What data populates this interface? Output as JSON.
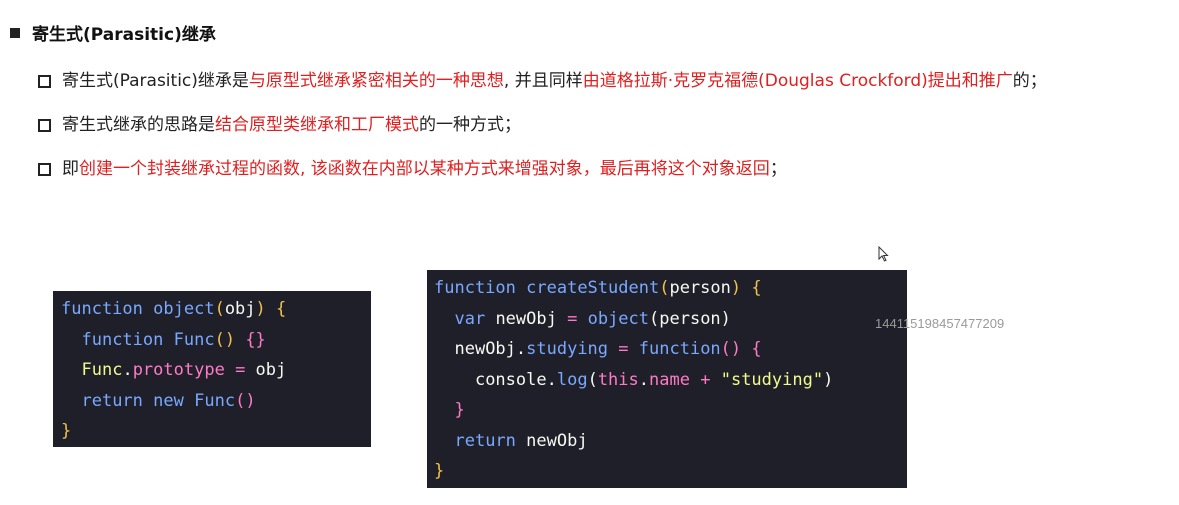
{
  "heading": "寄生式(Parasitic)继承",
  "bullets": [
    {
      "parts": [
        {
          "t": "寄生式(Parasitic)继承是",
          "red": false
        },
        {
          "t": "与原型式继承紧密相关的一种思想",
          "red": true
        },
        {
          "t": ", 并且同样",
          "red": false
        },
        {
          "t": "由道格拉斯·克罗克福德(Douglas Crockford)提出和推广",
          "red": true
        },
        {
          "t": "的；",
          "red": false
        }
      ]
    },
    {
      "parts": [
        {
          "t": "寄生式继承的思路是",
          "red": false
        },
        {
          "t": "结合原型类继承和工厂模式",
          "red": true
        },
        {
          "t": "的一种方式；",
          "red": false
        }
      ]
    },
    {
      "parts": [
        {
          "t": "即",
          "red": false
        },
        {
          "t": "创建一个封装继承过程的函数, 该函数在内部以某种方式来增强对象，最后再将这个对象返回",
          "red": true
        },
        {
          "t": "；",
          "red": false
        }
      ]
    }
  ],
  "code_blocks": [
    {
      "name": "object-function-code",
      "lines": [
        [
          [
            "function",
            "kw"
          ],
          [
            " ",
            ""
          ],
          [
            "object",
            "fn"
          ],
          [
            "(",
            "br"
          ],
          [
            "obj",
            ""
          ],
          [
            ")",
            "br"
          ],
          [
            " ",
            ""
          ],
          [
            "{",
            "br"
          ]
        ],
        [
          [
            "  ",
            ""
          ],
          [
            "function",
            "kw"
          ],
          [
            " ",
            ""
          ],
          [
            "Func",
            "fn"
          ],
          [
            "()",
            "br"
          ],
          [
            " ",
            ""
          ],
          [
            "{}",
            "pr"
          ]
        ],
        [
          [
            "  ",
            ""
          ],
          [
            "Func",
            "st"
          ],
          [
            ".",
            ""
          ],
          [
            "prototype",
            "pr"
          ],
          [
            " ",
            ""
          ],
          [
            "=",
            "pr"
          ],
          [
            " obj",
            ""
          ]
        ],
        [
          [
            "  ",
            ""
          ],
          [
            "return",
            "kw"
          ],
          [
            " ",
            ""
          ],
          [
            "new",
            "kw"
          ],
          [
            " ",
            ""
          ],
          [
            "Func",
            "fn"
          ],
          [
            "()",
            "pr"
          ]
        ],
        [
          [
            "}",
            "br"
          ]
        ]
      ]
    },
    {
      "name": "createStudent-function-code",
      "lines": [
        [
          [
            "function",
            "kw"
          ],
          [
            " ",
            ""
          ],
          [
            "createStudent",
            "fn"
          ],
          [
            "(",
            "br"
          ],
          [
            "person",
            ""
          ],
          [
            ")",
            "br"
          ],
          [
            " ",
            ""
          ],
          [
            "{",
            "br"
          ]
        ],
        [
          [
            "  ",
            ""
          ],
          [
            "var",
            "kw"
          ],
          [
            " newObj ",
            ""
          ],
          [
            "=",
            "pr"
          ],
          [
            " ",
            ""
          ],
          [
            "object",
            "fn"
          ],
          [
            "(person)",
            ""
          ]
        ],
        [
          [
            "  ",
            ""
          ],
          [
            "newObj.",
            ""
          ],
          [
            "studying",
            "fn"
          ],
          [
            " ",
            ""
          ],
          [
            "=",
            "pr"
          ],
          [
            " ",
            ""
          ],
          [
            "function",
            "kw"
          ],
          [
            "()",
            "pr"
          ],
          [
            " ",
            ""
          ],
          [
            "{",
            "pr"
          ]
        ],
        [
          [
            "    ",
            ""
          ],
          [
            "console.",
            ""
          ],
          [
            "log",
            "fn"
          ],
          [
            "(",
            ""
          ],
          [
            "this",
            "pr"
          ],
          [
            ".",
            ""
          ],
          [
            "name",
            "pr"
          ],
          [
            " ",
            ""
          ],
          [
            "+",
            "pr"
          ],
          [
            " ",
            ""
          ],
          [
            "\"studying\"",
            "st"
          ],
          [
            ")",
            ""
          ]
        ],
        [
          [
            "  ",
            ""
          ],
          [
            "}",
            "pr"
          ]
        ],
        [
          [
            "  ",
            ""
          ],
          [
            "return",
            "kw"
          ],
          [
            " newObj",
            ""
          ]
        ],
        [
          [
            "}",
            "br"
          ]
        ]
      ]
    }
  ],
  "watermark": "144115198457477209"
}
